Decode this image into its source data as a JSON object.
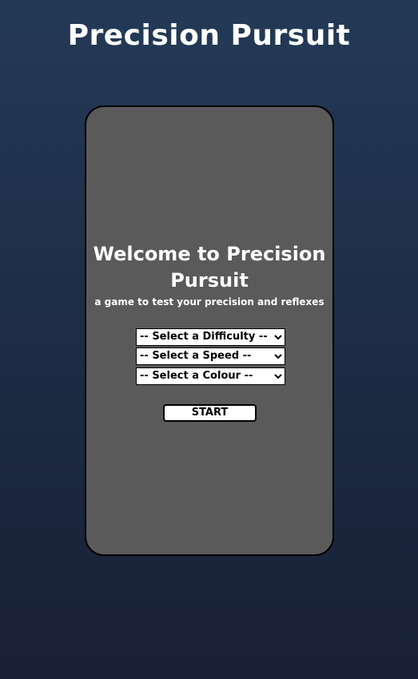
{
  "header": {
    "title": "Precision Pursuit"
  },
  "panel": {
    "welcome_title": "Welcome to Precision Pursuit",
    "tagline": "a game to test your precision and reflexes",
    "difficulty_select": {
      "selected": "-- Select a Difficulty --"
    },
    "speed_select": {
      "selected": "-- Select a Speed --"
    },
    "colour_select": {
      "selected": "-- Select a Colour --"
    },
    "start_label": "START"
  },
  "colors": {
    "background_top": "#233a57",
    "background_bottom": "#182035",
    "panel": "#5a5a5a",
    "text": "#ffffff"
  },
  "icons": {
    "select_arrow": "chevron-down-icon"
  }
}
